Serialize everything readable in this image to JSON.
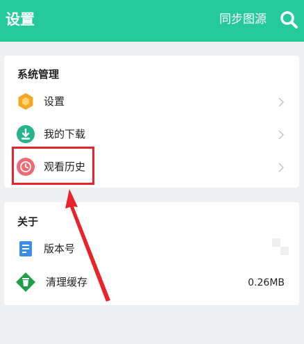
{
  "header": {
    "title": "设置",
    "sync_label": "同步图源",
    "search_icon": "search-icon"
  },
  "system_section": {
    "title": "系统管理",
    "items": [
      {
        "label": "设置",
        "icon": "hexagon-settings-icon",
        "icon_color": "#f5a623"
      },
      {
        "label": "我的下载",
        "icon": "download-icon",
        "icon_color": "#26b58a"
      },
      {
        "label": "观看历史",
        "icon": "clock-icon",
        "icon_color": "#ef6b73"
      }
    ]
  },
  "about_section": {
    "title": "关于",
    "items": [
      {
        "label": "版本号",
        "icon": "document-icon",
        "icon_color": "#3b8de8"
      },
      {
        "label": "清理缓存",
        "value": "0.26MB",
        "icon": "trash-icon",
        "icon_color": "#1f9e4a"
      }
    ]
  },
  "colors": {
    "accent": "#26c99a",
    "annotation": "#e8232a"
  }
}
